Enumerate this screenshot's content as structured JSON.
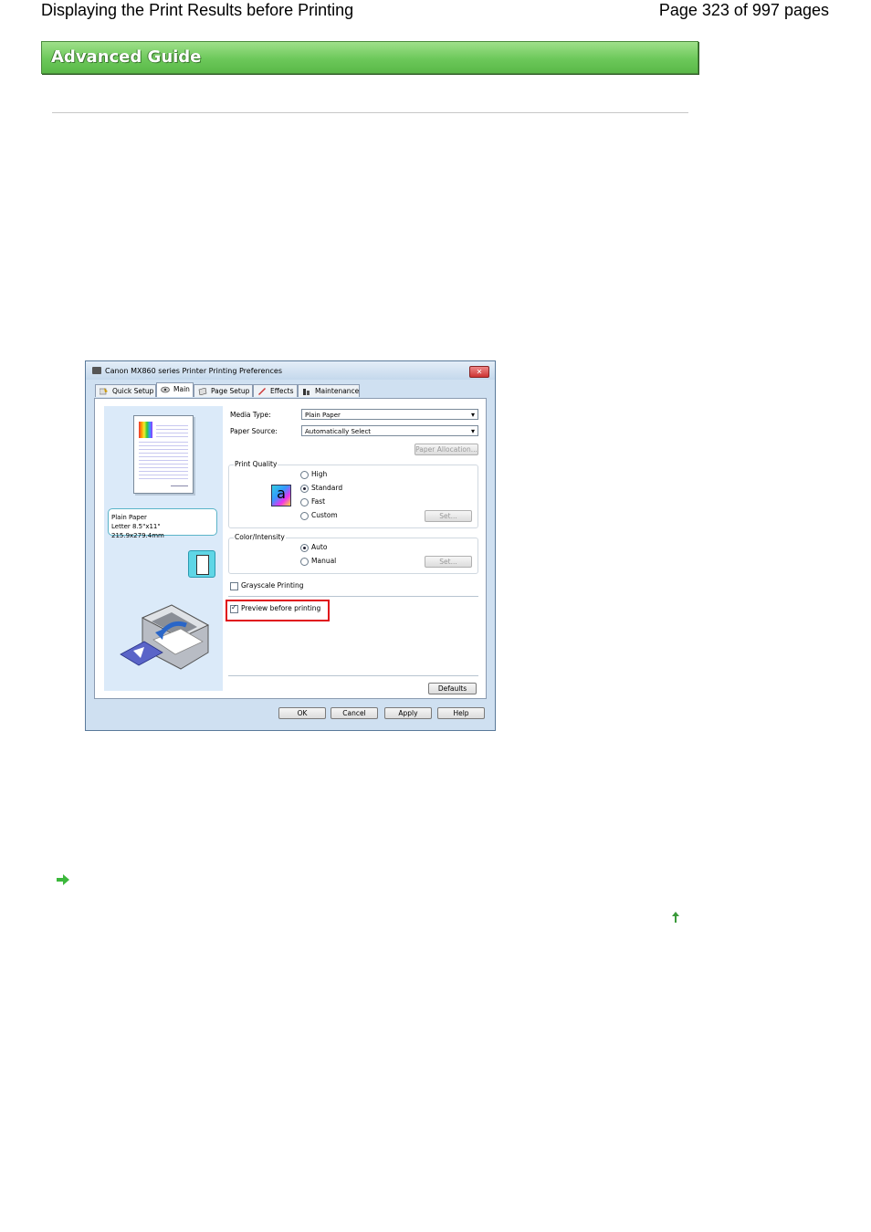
{
  "header": {
    "title": "Displaying the Print Results before Printing",
    "page_info": "Page 323 of 997 pages"
  },
  "banner": {
    "label": "Advanced Guide"
  },
  "colors": {
    "banner_green": "#6cc85a",
    "highlight_red": "#e0101a"
  },
  "dialog": {
    "title": "Canon MX860 series Printer Printing Preferences",
    "close_icon": "close-icon",
    "tabs": [
      {
        "label": "Quick Setup"
      },
      {
        "label": "Main"
      },
      {
        "label": "Page Setup"
      },
      {
        "label": "Effects"
      },
      {
        "label": "Maintenance"
      }
    ],
    "media_info": {
      "line1": "Plain Paper",
      "line2": "Letter 8.5\"x11\" 215.9x279.4mm"
    },
    "media_type": {
      "label": "Media Type:",
      "value": "Plain Paper"
    },
    "paper_source": {
      "label": "Paper Source:",
      "value": "Automatically Select"
    },
    "paper_allocation_button": "Paper Allocation...",
    "print_quality": {
      "title": "Print Quality",
      "options": [
        "High",
        "Standard",
        "Fast",
        "Custom"
      ],
      "selected": "Standard",
      "set_button": "Set..."
    },
    "color_intensity": {
      "title": "Color/Intensity",
      "options": [
        "Auto",
        "Manual"
      ],
      "selected": "Auto",
      "set_button": "Set..."
    },
    "grayscale": {
      "label": "Grayscale Printing",
      "checked": false
    },
    "preview": {
      "label": "Preview before printing",
      "checked": true
    },
    "defaults_button": "Defaults",
    "ok_button": "OK",
    "cancel_button": "Cancel",
    "apply_button": "Apply",
    "help_button": "Help"
  }
}
